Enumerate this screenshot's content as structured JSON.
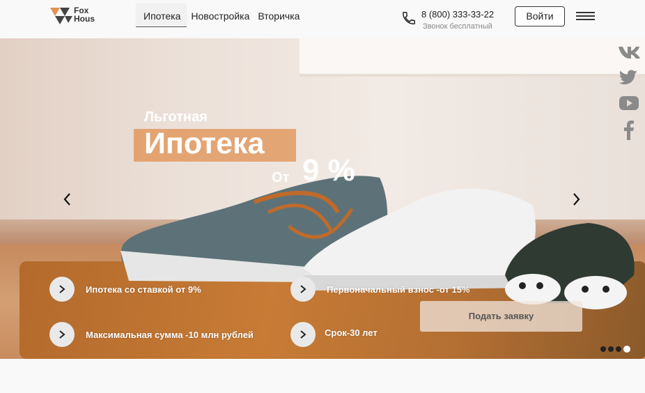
{
  "header": {
    "logo_line1": "Fox",
    "logo_line2": "Hous",
    "nav": [
      "Ипотека",
      "Новостройка",
      "Вторичка"
    ],
    "phone": "8 (800) 333-33-22",
    "phone_note": "Звонок бесплатный",
    "login_label": "Войти"
  },
  "hero": {
    "subtitle": "Льготная",
    "title": "Ипотека",
    "rate_prefix": "От",
    "rate": "9 %",
    "features": [
      "Ипотека со ставкой от 9%",
      "Первоначальный взнос -от 15%",
      "Максимальная сумма -10 млн рублей",
      "Срок-30 лет"
    ],
    "apply_label": "Подать заявку",
    "slides_total": 4,
    "active_slide": 4
  },
  "social": [
    "vk-icon",
    "twitter-icon",
    "youtube-icon",
    "facebook-icon"
  ],
  "colors": {
    "accent": "#e09356",
    "text_dark": "#222222"
  }
}
